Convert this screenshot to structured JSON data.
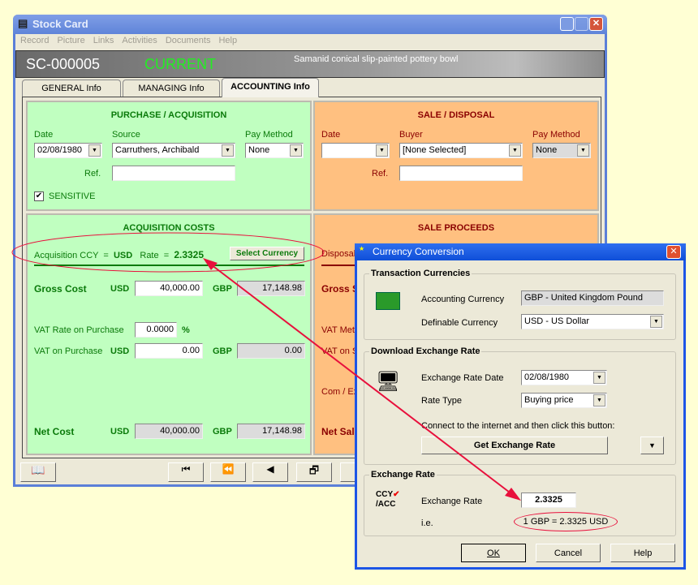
{
  "window": {
    "title": "Stock Card",
    "menu": [
      "Record",
      "Picture",
      "Links",
      "Activities",
      "Documents",
      "Help"
    ]
  },
  "header": {
    "code": "SC-000005",
    "status": "CURRENT",
    "description": "Samanid conical slip-painted pottery bowl"
  },
  "tabs": [
    "GENERAL Info",
    "MANAGING Info",
    "ACCOUNTING Info"
  ],
  "purchase": {
    "title": "PURCHASE / ACQUISITION",
    "date_label": "Date",
    "date": "02/08/1980",
    "source_label": "Source",
    "source": "Carruthers, Archibald",
    "pay_label": "Pay Method",
    "pay": "None",
    "ref_label": "Ref.",
    "ref": "",
    "sensitive_label": "SENSITIVE",
    "sensitive": true
  },
  "sale": {
    "title": "SALE / DISPOSAL",
    "date_label": "Date",
    "date": "",
    "buyer_label": "Buyer",
    "buyer": "[None Selected]",
    "pay_label": "Pay Method",
    "pay": "None",
    "ref_label": "Ref.",
    "ref": ""
  },
  "costs": {
    "title": "ACQUISITION COSTS",
    "ccy_label": "Acquisition CCY",
    "eq": "=",
    "ccy": "USD",
    "rate_label": "Rate",
    "rate": "2.3325",
    "select_button": "Select Currency",
    "gross_label": "Gross Cost",
    "usd": "USD",
    "gbp": "GBP",
    "gross_usd": "40,000.00",
    "gross_gbp": "17,148.98",
    "vat_rate_label": "VAT Rate on Purchase",
    "vat_rate": "0.0000",
    "pct": "%",
    "vat_label": "VAT on Purchase",
    "vat_usd": "0.00",
    "vat_gbp": "0.00",
    "net_label": "Net Cost",
    "net_usd": "40,000.00",
    "net_gbp": "17,148.98"
  },
  "proceeds": {
    "title": "SALE PROCEEDS",
    "disposal": "Disposal",
    "gross": "Gross S",
    "vat_method": "VAT Meth",
    "vat_on": "VAT on S",
    "com": "Com / Ex",
    "net": "Net Sale"
  },
  "dialog": {
    "title": "Currency Conversion",
    "g1": "Transaction Currencies",
    "acc_label": "Accounting Currency",
    "acc": "GBP - United Kingdom Pound",
    "def_label": "Definable Currency",
    "def": "USD - US Dollar",
    "g2": "Download Exchange Rate",
    "date_label": "Exchange Rate Date",
    "date": "02/08/1980",
    "type_label": "Rate Type",
    "type": "Buying price",
    "connect": "Connect to the internet and then click this button:",
    "get_button": "Get Exchange Rate",
    "g3": "Exchange Rate",
    "rate_label": "Exchange Rate",
    "rate": "2.3325",
    "ie": "i.e.",
    "equiv": "1 GBP = 2.3325 USD",
    "ok": "OK",
    "cancel": "Cancel",
    "help": "Help"
  },
  "colors": {
    "purchase_bg": "#c0ffc0",
    "sale_bg": "#ffc080",
    "annotation": "#e8103c"
  }
}
